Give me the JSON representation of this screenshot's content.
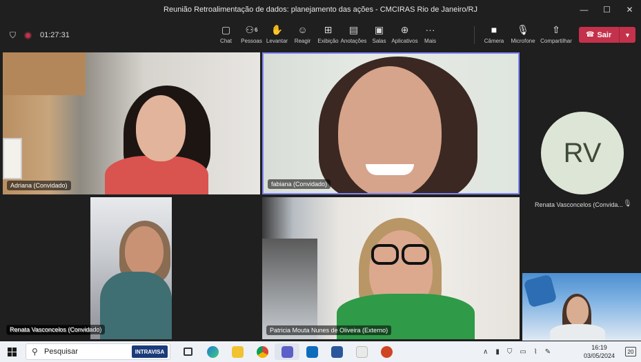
{
  "window": {
    "title": "Reunião Retroalimentação de dados: planejamento das ações - CMCIRAS Rio de Janeiro/RJ",
    "controls": [
      "—",
      "☐",
      "✕"
    ]
  },
  "toolbar": {
    "timer": "01:27:31",
    "tools": [
      {
        "label": "Chat",
        "icon": "chat-icon",
        "glyph": "▢"
      },
      {
        "label": "Pessoas",
        "icon": "people-icon",
        "glyph": "⚇",
        "count": "6"
      },
      {
        "label": "Levantar",
        "icon": "raise-hand-icon",
        "glyph": "✋"
      },
      {
        "label": "Reagir",
        "icon": "react-icon",
        "glyph": "☺"
      },
      {
        "label": "Exibição",
        "icon": "view-icon",
        "glyph": "⊞"
      },
      {
        "label": "Anotações",
        "icon": "notes-icon",
        "glyph": "▤"
      },
      {
        "label": "Salas",
        "icon": "rooms-icon",
        "glyph": "▣"
      },
      {
        "label": "Aplicativos",
        "icon": "apps-icon",
        "glyph": "⊕"
      },
      {
        "label": "Mais",
        "icon": "more-icon",
        "glyph": "···"
      }
    ],
    "devices": [
      {
        "label": "Câmera",
        "icon": "camera-icon",
        "glyph": "■"
      },
      {
        "label": "Microfone",
        "icon": "microphone-icon",
        "glyph": "🎙"
      },
      {
        "label": "Compartilhar",
        "icon": "share-icon",
        "glyph": "⇧"
      }
    ],
    "leave_label": "Sair"
  },
  "participants": {
    "adriana": "Adriana (Convidado)",
    "fabiana": "fabiana (Convidado)",
    "renata_avatar_initials": "RV",
    "renata_avatar_name": "Renata Vasconcelos (Convida...",
    "renata_video": "Renata Vasconcelos (Convidado)",
    "patricia": "Patricia Mouta Nunes de Oliveira (Externo)"
  },
  "taskbar": {
    "search_placeholder": "Pesquisar",
    "search_badge": "INTRAVISA",
    "time": "16:19",
    "date": "03/05/2024",
    "notifications": "20"
  },
  "colors": {
    "leave": "#c4314b",
    "active_speaker_border": "#7f85f5",
    "avatar_bg": "#dde6d6"
  }
}
